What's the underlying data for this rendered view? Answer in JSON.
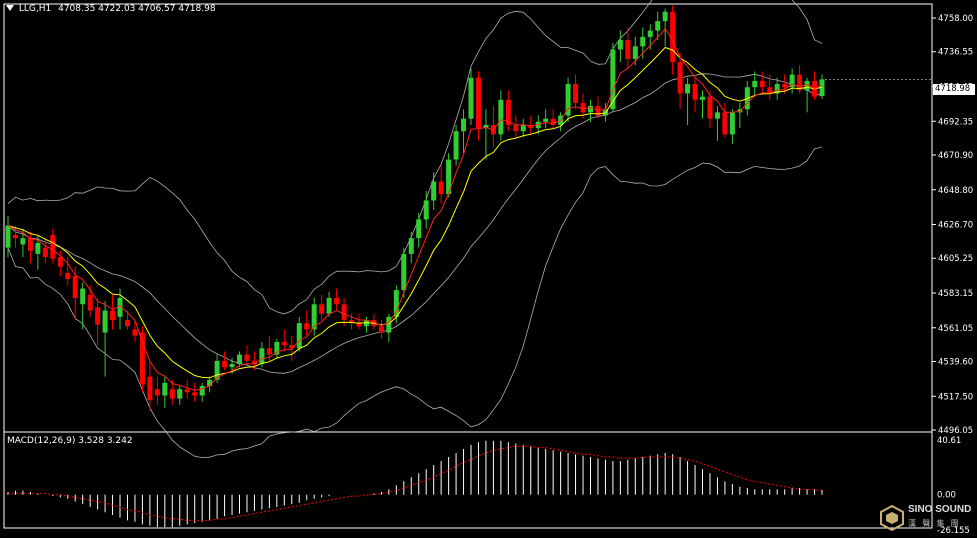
{
  "header": {
    "symbol_label": "LLG,H1",
    "ohlc_text": "4708.35 4722.03 4706.57 4718.98"
  },
  "price_axis": {
    "labels": [
      "4758.00",
      "4736.55",
      "4714.45",
      "4692.35",
      "4670.90",
      "4648.80",
      "4626.70",
      "4605.25",
      "4583.15",
      "4561.05",
      "4539.60",
      "4517.50",
      "4496.05"
    ],
    "current_price": "4718.98"
  },
  "macd_panel": {
    "title": "MACD(12,26,9) 3.528 3.242",
    "axis_labels": [
      "40.61",
      "0.00",
      "-26.155"
    ]
  },
  "logo": {
    "brand": "SINO SOUND",
    "sub": "漢 聲 集 團"
  },
  "colors": {
    "background": "#000000",
    "bull_candle": "#32cd32",
    "bear_candle": "#ff0000",
    "bollinger": "#b0b0b0",
    "ma_fast": "#ff2020",
    "ma_slow": "#ffff00",
    "macd_hist": "#ffffff",
    "macd_signal": "#ff0000"
  },
  "chart_data": {
    "type": "candlestick",
    "symbol": "LLG",
    "timeframe": "H1",
    "ylim": [
      4496.05,
      4758.0
    ],
    "macd_ylim": [
      -26.155,
      40.61
    ],
    "candles": [
      {
        "o": 4612,
        "h": 4632,
        "l": 4606,
        "c": 4626
      },
      {
        "o": 4620,
        "h": 4626,
        "l": 4612,
        "c": 4618
      },
      {
        "o": 4614,
        "h": 4624,
        "l": 4606,
        "c": 4618
      },
      {
        "o": 4618,
        "h": 4622,
        "l": 4602,
        "c": 4610
      },
      {
        "o": 4608,
        "h": 4620,
        "l": 4598,
        "c": 4615
      },
      {
        "o": 4612,
        "h": 4618,
        "l": 4602,
        "c": 4606
      },
      {
        "o": 4620,
        "h": 4624,
        "l": 4602,
        "c": 4605
      },
      {
        "o": 4606,
        "h": 4610,
        "l": 4594,
        "c": 4600
      },
      {
        "o": 4596,
        "h": 4606,
        "l": 4588,
        "c": 4592
      },
      {
        "o": 4594,
        "h": 4600,
        "l": 4566,
        "c": 4580
      },
      {
        "o": 4576,
        "h": 4590,
        "l": 4560,
        "c": 4586
      },
      {
        "o": 4582,
        "h": 4588,
        "l": 4568,
        "c": 4572
      },
      {
        "o": 4574,
        "h": 4580,
        "l": 4550,
        "c": 4563
      },
      {
        "o": 4558,
        "h": 4578,
        "l": 4530,
        "c": 4572
      },
      {
        "o": 4572,
        "h": 4582,
        "l": 4560,
        "c": 4566
      },
      {
        "o": 4568,
        "h": 4586,
        "l": 4560,
        "c": 4580
      },
      {
        "o": 4566,
        "h": 4572,
        "l": 4560,
        "c": 4562
      },
      {
        "o": 4560,
        "h": 4566,
        "l": 4552,
        "c": 4556
      },
      {
        "o": 4558,
        "h": 4562,
        "l": 4520,
        "c": 4525
      },
      {
        "o": 4530,
        "h": 4540,
        "l": 4508,
        "c": 4515
      },
      {
        "o": 4522,
        "h": 4530,
        "l": 4512,
        "c": 4518
      },
      {
        "o": 4518,
        "h": 4530,
        "l": 4510,
        "c": 4526
      },
      {
        "o": 4522,
        "h": 4528,
        "l": 4512,
        "c": 4516
      },
      {
        "o": 4516,
        "h": 4524,
        "l": 4512,
        "c": 4522
      },
      {
        "o": 4522,
        "h": 4528,
        "l": 4516,
        "c": 4520
      },
      {
        "o": 4520,
        "h": 4526,
        "l": 4514,
        "c": 4518
      },
      {
        "o": 4518,
        "h": 4526,
        "l": 4514,
        "c": 4524
      },
      {
        "o": 4524,
        "h": 4530,
        "l": 4520,
        "c": 4528
      },
      {
        "o": 4528,
        "h": 4544,
        "l": 4526,
        "c": 4540
      },
      {
        "o": 4540,
        "h": 4546,
        "l": 4534,
        "c": 4536
      },
      {
        "o": 4536,
        "h": 4542,
        "l": 4532,
        "c": 4538
      },
      {
        "o": 4538,
        "h": 4546,
        "l": 4536,
        "c": 4544
      },
      {
        "o": 4544,
        "h": 4550,
        "l": 4538,
        "c": 4540
      },
      {
        "o": 4540,
        "h": 4546,
        "l": 4534,
        "c": 4538
      },
      {
        "o": 4538,
        "h": 4552,
        "l": 4536,
        "c": 4548
      },
      {
        "o": 4548,
        "h": 4556,
        "l": 4540,
        "c": 4544
      },
      {
        "o": 4544,
        "h": 4554,
        "l": 4542,
        "c": 4552
      },
      {
        "o": 4552,
        "h": 4560,
        "l": 4546,
        "c": 4550
      },
      {
        "o": 4550,
        "h": 4556,
        "l": 4540,
        "c": 4548
      },
      {
        "o": 4548,
        "h": 4568,
        "l": 4546,
        "c": 4564
      },
      {
        "o": 4564,
        "h": 4572,
        "l": 4556,
        "c": 4560
      },
      {
        "o": 4560,
        "h": 4580,
        "l": 4556,
        "c": 4576
      },
      {
        "o": 4576,
        "h": 4582,
        "l": 4566,
        "c": 4570
      },
      {
        "o": 4570,
        "h": 4584,
        "l": 4568,
        "c": 4580
      },
      {
        "o": 4580,
        "h": 4586,
        "l": 4572,
        "c": 4576
      },
      {
        "o": 4576,
        "h": 4580,
        "l": 4562,
        "c": 4566
      },
      {
        "o": 4566,
        "h": 4570,
        "l": 4560,
        "c": 4564
      },
      {
        "o": 4564,
        "h": 4570,
        "l": 4560,
        "c": 4562
      },
      {
        "o": 4562,
        "h": 4568,
        "l": 4558,
        "c": 4566
      },
      {
        "o": 4566,
        "h": 4570,
        "l": 4560,
        "c": 4562
      },
      {
        "o": 4562,
        "h": 4566,
        "l": 4554,
        "c": 4558
      },
      {
        "o": 4558,
        "h": 4570,
        "l": 4552,
        "c": 4568
      },
      {
        "o": 4568,
        "h": 4588,
        "l": 4564,
        "c": 4585
      },
      {
        "o": 4585,
        "h": 4612,
        "l": 4580,
        "c": 4608
      },
      {
        "o": 4608,
        "h": 4622,
        "l": 4602,
        "c": 4618
      },
      {
        "o": 4618,
        "h": 4634,
        "l": 4612,
        "c": 4630
      },
      {
        "o": 4630,
        "h": 4648,
        "l": 4624,
        "c": 4642
      },
      {
        "o": 4642,
        "h": 4660,
        "l": 4636,
        "c": 4654
      },
      {
        "o": 4654,
        "h": 4664,
        "l": 4640,
        "c": 4646
      },
      {
        "o": 4646,
        "h": 4672,
        "l": 4644,
        "c": 4668
      },
      {
        "o": 4668,
        "h": 4690,
        "l": 4664,
        "c": 4686
      },
      {
        "o": 4686,
        "h": 4700,
        "l": 4672,
        "c": 4694
      },
      {
        "o": 4694,
        "h": 4726,
        "l": 4690,
        "c": 4720
      },
      {
        "o": 4720,
        "h": 4724,
        "l": 4680,
        "c": 4688
      },
      {
        "o": 4688,
        "h": 4700,
        "l": 4668,
        "c": 4690
      },
      {
        "o": 4690,
        "h": 4702,
        "l": 4676,
        "c": 4684
      },
      {
        "o": 4684,
        "h": 4712,
        "l": 4680,
        "c": 4706
      },
      {
        "o": 4706,
        "h": 4712,
        "l": 4686,
        "c": 4690
      },
      {
        "o": 4690,
        "h": 4696,
        "l": 4682,
        "c": 4686
      },
      {
        "o": 4686,
        "h": 4694,
        "l": 4682,
        "c": 4690
      },
      {
        "o": 4690,
        "h": 4696,
        "l": 4684,
        "c": 4688
      },
      {
        "o": 4688,
        "h": 4696,
        "l": 4684,
        "c": 4692
      },
      {
        "o": 4692,
        "h": 4700,
        "l": 4688,
        "c": 4694
      },
      {
        "o": 4694,
        "h": 4700,
        "l": 4688,
        "c": 4690
      },
      {
        "o": 4690,
        "h": 4698,
        "l": 4686,
        "c": 4696
      },
      {
        "o": 4696,
        "h": 4720,
        "l": 4692,
        "c": 4716
      },
      {
        "o": 4716,
        "h": 4722,
        "l": 4700,
        "c": 4704
      },
      {
        "o": 4704,
        "h": 4710,
        "l": 4694,
        "c": 4698
      },
      {
        "o": 4698,
        "h": 4706,
        "l": 4692,
        "c": 4702
      },
      {
        "o": 4702,
        "h": 4708,
        "l": 4694,
        "c": 4696
      },
      {
        "o": 4696,
        "h": 4704,
        "l": 4692,
        "c": 4700
      },
      {
        "o": 4700,
        "h": 4742,
        "l": 4698,
        "c": 4738
      },
      {
        "o": 4738,
        "h": 4750,
        "l": 4730,
        "c": 4744
      },
      {
        "o": 4744,
        "h": 4752,
        "l": 4726,
        "c": 4732
      },
      {
        "o": 4732,
        "h": 4746,
        "l": 4728,
        "c": 4740
      },
      {
        "o": 4740,
        "h": 4752,
        "l": 4732,
        "c": 4746
      },
      {
        "o": 4746,
        "h": 4754,
        "l": 4738,
        "c": 4750
      },
      {
        "o": 4750,
        "h": 4762,
        "l": 4744,
        "c": 4756
      },
      {
        "o": 4756,
        "h": 4764,
        "l": 4740,
        "c": 4762
      },
      {
        "o": 4762,
        "h": 4766,
        "l": 4722,
        "c": 4730
      },
      {
        "o": 4730,
        "h": 4736,
        "l": 4700,
        "c": 4710
      },
      {
        "o": 4710,
        "h": 4720,
        "l": 4690,
        "c": 4716
      },
      {
        "o": 4716,
        "h": 4722,
        "l": 4698,
        "c": 4706
      },
      {
        "o": 4706,
        "h": 4712,
        "l": 4694,
        "c": 4708
      },
      {
        "o": 4708,
        "h": 4712,
        "l": 4688,
        "c": 4694
      },
      {
        "o": 4694,
        "h": 4702,
        "l": 4680,
        "c": 4698
      },
      {
        "o": 4698,
        "h": 4704,
        "l": 4682,
        "c": 4684
      },
      {
        "o": 4684,
        "h": 4700,
        "l": 4678,
        "c": 4698
      },
      {
        "o": 4698,
        "h": 4704,
        "l": 4688,
        "c": 4700
      },
      {
        "o": 4700,
        "h": 4718,
        "l": 4696,
        "c": 4714
      },
      {
        "o": 4714,
        "h": 4724,
        "l": 4708,
        "c": 4718
      },
      {
        "o": 4718,
        "h": 4724,
        "l": 4710,
        "c": 4714
      },
      {
        "o": 4714,
        "h": 4722,
        "l": 4706,
        "c": 4710
      },
      {
        "o": 4710,
        "h": 4720,
        "l": 4706,
        "c": 4716
      },
      {
        "o": 4716,
        "h": 4722,
        "l": 4710,
        "c": 4714
      },
      {
        "o": 4714,
        "h": 4726,
        "l": 4710,
        "c": 4722
      },
      {
        "o": 4722,
        "h": 4728,
        "l": 4710,
        "c": 4712
      },
      {
        "o": 4712,
        "h": 4720,
        "l": 4698,
        "c": 4718
      },
      {
        "o": 4718,
        "h": 4724,
        "l": 4706,
        "c": 4708
      },
      {
        "o": 4708.35,
        "h": 4722.03,
        "l": 4706.57,
        "c": 4718.98
      }
    ],
    "macd_hist": [
      2,
      3,
      3,
      2,
      1,
      0,
      -1,
      -2,
      -3,
      -5,
      -7,
      -9,
      -11,
      -13,
      -15,
      -17,
      -19,
      -20,
      -22,
      -23,
      -24,
      -24,
      -24,
      -23,
      -22,
      -21,
      -20,
      -19,
      -18,
      -16,
      -15,
      -14,
      -13,
      -12,
      -11,
      -10,
      -9,
      -8,
      -7,
      -6,
      -4,
      -3,
      -2,
      -1,
      0,
      0,
      0,
      0,
      0,
      1,
      2,
      4,
      7,
      10,
      13,
      16,
      19,
      22,
      25,
      28,
      31,
      34,
      37,
      39,
      40,
      40,
      40,
      39,
      38,
      37,
      36,
      35,
      34,
      33,
      32,
      31,
      30,
      29,
      28,
      27,
      26,
      25,
      25,
      26,
      27,
      28,
      29,
      30,
      31,
      30,
      28,
      25,
      22,
      19,
      16,
      13,
      10,
      8,
      6,
      5,
      4,
      4,
      4,
      4,
      4,
      5,
      5,
      4,
      4,
      3.5
    ],
    "macd_signal": [
      1,
      1,
      1,
      1,
      1,
      1,
      0,
      0,
      -1,
      -2,
      -3,
      -4,
      -5,
      -6,
      -8,
      -9,
      -11,
      -12,
      -13,
      -15,
      -16,
      -17,
      -18,
      -18,
      -19,
      -19,
      -19,
      -19,
      -18,
      -18,
      -17,
      -16,
      -15,
      -14,
      -13,
      -12,
      -11,
      -10,
      -9,
      -8,
      -7,
      -6,
      -5,
      -4,
      -3,
      -2,
      -1,
      -1,
      0,
      0,
      1,
      2,
      3,
      5,
      7,
      9,
      11,
      13,
      16,
      18,
      21,
      24,
      26,
      29,
      31,
      33,
      34,
      35,
      36,
      36,
      36,
      35,
      35,
      34,
      33,
      32,
      31,
      30,
      30,
      29,
      28,
      28,
      27,
      27,
      27,
      28,
      28,
      28,
      28,
      28,
      27,
      26,
      25,
      23,
      21,
      19,
      17,
      15,
      13,
      11,
      10,
      9,
      8,
      7,
      6,
      5,
      4,
      4,
      3.5,
      3.2
    ]
  }
}
